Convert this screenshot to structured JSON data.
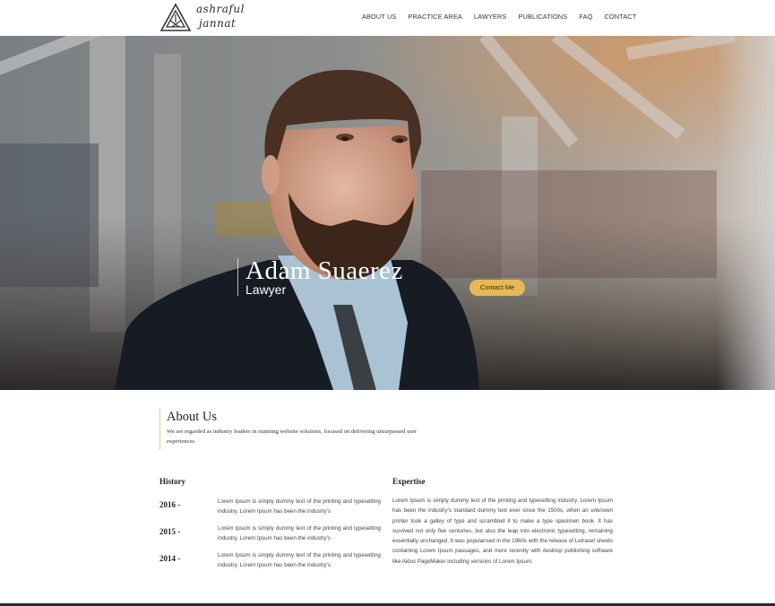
{
  "brand": {
    "line1": "ashraful",
    "line2": "jannat",
    "logo_icon": "triangle-knot-icon"
  },
  "nav": {
    "items": [
      "ABOUT US",
      "PRACTICE AREA",
      "LAWYERS",
      "PUBLICATIONS",
      "FAQ",
      "CONTACT"
    ]
  },
  "hero": {
    "name": "Adam Suaerez",
    "role": "Lawyer",
    "cta_label": "Contact Me",
    "cta_color": "#e6b954"
  },
  "about": {
    "title": "About Us",
    "description": "We are regarded as industry leaders in stunning website solutions, focused on delivering unsurpassed user experiences"
  },
  "history": {
    "title": "History",
    "entries": [
      {
        "year": "2016 -",
        "text": "Lorem Ipsum is simply dummy text of the printing and typesetting industry. Lorem Ipsum has been the industry's"
      },
      {
        "year": "2015 -",
        "text": "Lorem Ipsum is simply dummy text of the printing and typesetting industry. Lorem Ipsum has been the industry's"
      },
      {
        "year": "2014 -",
        "text": "Lorem Ipsum is simply dummy text of the printing and typesetting industry. Lorem Ipsum has been the industry's"
      }
    ]
  },
  "expertise": {
    "title": "Expertise",
    "text": "Lorem Ipsum is simply dummy text of the printing and typesetting industry. Lorem Ipsum has been the industry's standard dummy text ever since the 1500s, when an unknown printer took a galley of type and scrambled it to make a type specimen book. It has survived not only five centuries, but also the leap into electronic typesetting, remaining essentially unchanged. It was popularised in the 1960s with the release of Letraset sheets containing Lorem Ipsum passages, and more recently with desktop publishing software like Aldus PageMaker including versions of Lorem Ipsum."
  }
}
